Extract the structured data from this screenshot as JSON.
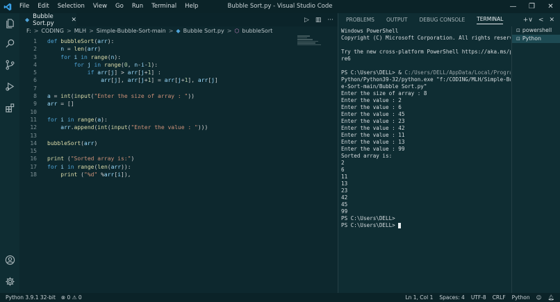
{
  "window": {
    "title": "Bubble Sort.py - Visual Studio Code"
  },
  "menu": [
    "File",
    "Edit",
    "Selection",
    "View",
    "Go",
    "Run",
    "Terminal",
    "Help"
  ],
  "window_controls": {
    "minimize": "—",
    "maximize": "❐",
    "close": "✕"
  },
  "editor": {
    "tab": {
      "label": "Bubble Sort.py",
      "close": "✕"
    },
    "breadcrumb": [
      "F:",
      "CODING",
      "MLH",
      "Simple-Bubble-Sort-main",
      "Bubble Sort.py",
      "bubbleSort"
    ],
    "line_numbers": [
      "1",
      "2",
      "3",
      "4",
      "5",
      "6",
      "7",
      "8",
      "9",
      "10",
      "11",
      "12",
      "13",
      "14",
      "15",
      "16",
      "17",
      "18"
    ]
  },
  "panel": {
    "tabs": [
      "PROBLEMS",
      "OUTPUT",
      "DEBUG CONSOLE",
      "TERMINAL"
    ],
    "actions": {
      "add": "+∨",
      "prev": "<",
      "close": "✕"
    },
    "terminal_lines": [
      "Windows PowerShell",
      "Copyright (C) Microsoft Corporation. All rights reserved.",
      "",
      "Try the new cross-platform PowerShell https://aka.ms/psco",
      "re6",
      "",
      "Enter the size of array : 8",
      "Enter the value : 2",
      "Enter the value : 6",
      "Enter the value : 45",
      "Enter the value : 23",
      "Enter the value : 42",
      "Enter the value : 11",
      "Enter the value : 13",
      "Enter the value : 99",
      "Sorted array is:",
      "2",
      "6",
      "11",
      "13",
      "23",
      "42",
      "45",
      "99",
      "PS C:\\Users\\DELL>"
    ],
    "run_cmd": {
      "prompt": "PS C:\\Users\\DELL> & ",
      "path1": "C:/Users/DELL/AppData/Local/Programs/",
      "path2": "Python/Python39-32/python.exe \"f:/CODING/MLH/Simple-Bubbl",
      "path3": "e-Sort-main/Bubble Sort.py\""
    },
    "last_prompt": "PS C:\\Users\\DELL> ",
    "terminal_list": [
      "powershell",
      "Python"
    ]
  },
  "status": {
    "python": "Python 3.9.1 32-bit",
    "errors": "⊗ 0 ⚠ 0",
    "position": "Ln 1, Col 1",
    "spaces": "Spaces: 4",
    "encoding": "UTF-8",
    "eol": "CRLF",
    "language": "Python"
  },
  "colors": {
    "accent": "#4ea3d6",
    "background": "#0d282e",
    "statusbar": "#0b2328"
  }
}
